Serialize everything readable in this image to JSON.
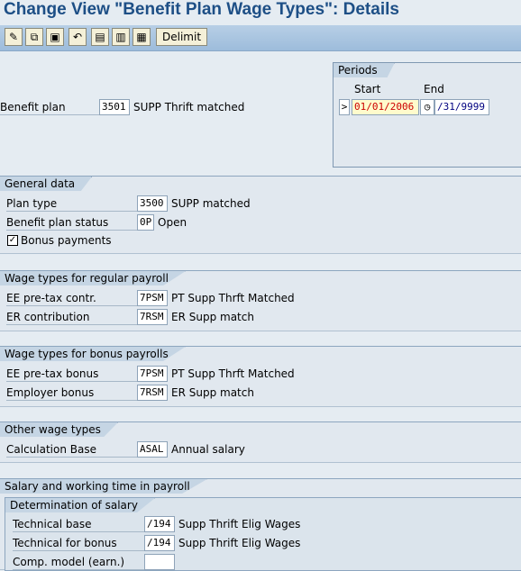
{
  "title": "Change View \"Benefit Plan Wage Types\": Details",
  "toolbar": {
    "icons": [
      "edit-icon",
      "copy-icon",
      "delete-icon",
      "undo-icon",
      "select-all-icon",
      "deselect-icon",
      "block-icon"
    ],
    "delimit_label": "Delimit"
  },
  "benefit_plan": {
    "label": "Benefit plan",
    "code": "3501",
    "desc": "SUPP Thrift matched"
  },
  "periods": {
    "title": "Periods",
    "start_label": "Start",
    "end_label": "End",
    "start_value": "01/01/2006",
    "end_value": "/31/9999",
    "arrow": ">"
  },
  "general": {
    "title": "General data",
    "plan_type": {
      "label": "Plan type",
      "code": "3500",
      "desc": "SUPP matched"
    },
    "status": {
      "label": "Benefit plan status",
      "code": "0P",
      "desc": "Open"
    },
    "bonus": {
      "label": "Bonus payments",
      "checked": true
    }
  },
  "regular": {
    "title": "Wage types for regular payroll",
    "ee": {
      "label": "EE pre-tax contr.",
      "code": "7PSM",
      "desc": "PT Supp Thrft Matched"
    },
    "er": {
      "label": "ER contribution",
      "code": "7RSM",
      "desc": "ER Supp match"
    }
  },
  "bonus_payroll": {
    "title": "Wage types for bonus payrolls",
    "ee": {
      "label": "EE pre-tax bonus",
      "code": "7PSM",
      "desc": "PT Supp Thrft Matched"
    },
    "er": {
      "label": "Employer bonus",
      "code": "7RSM",
      "desc": "ER Supp match"
    }
  },
  "other": {
    "title": "Other wage types",
    "calc": {
      "label": "Calculation Base",
      "code": "ASAL",
      "desc": "Annual salary"
    }
  },
  "salary": {
    "title": "Salary and working time in payroll",
    "det_title": "Determination of salary",
    "tech": {
      "label": "Technical base",
      "code": "/194",
      "desc": "Supp Thrift Elig Wages"
    },
    "tech_bonus": {
      "label": "Technical for bonus",
      "code": "/194",
      "desc": "Supp Thrift Elig Wages"
    },
    "comp": {
      "label": "Comp. model (earn.)",
      "code": ""
    }
  }
}
